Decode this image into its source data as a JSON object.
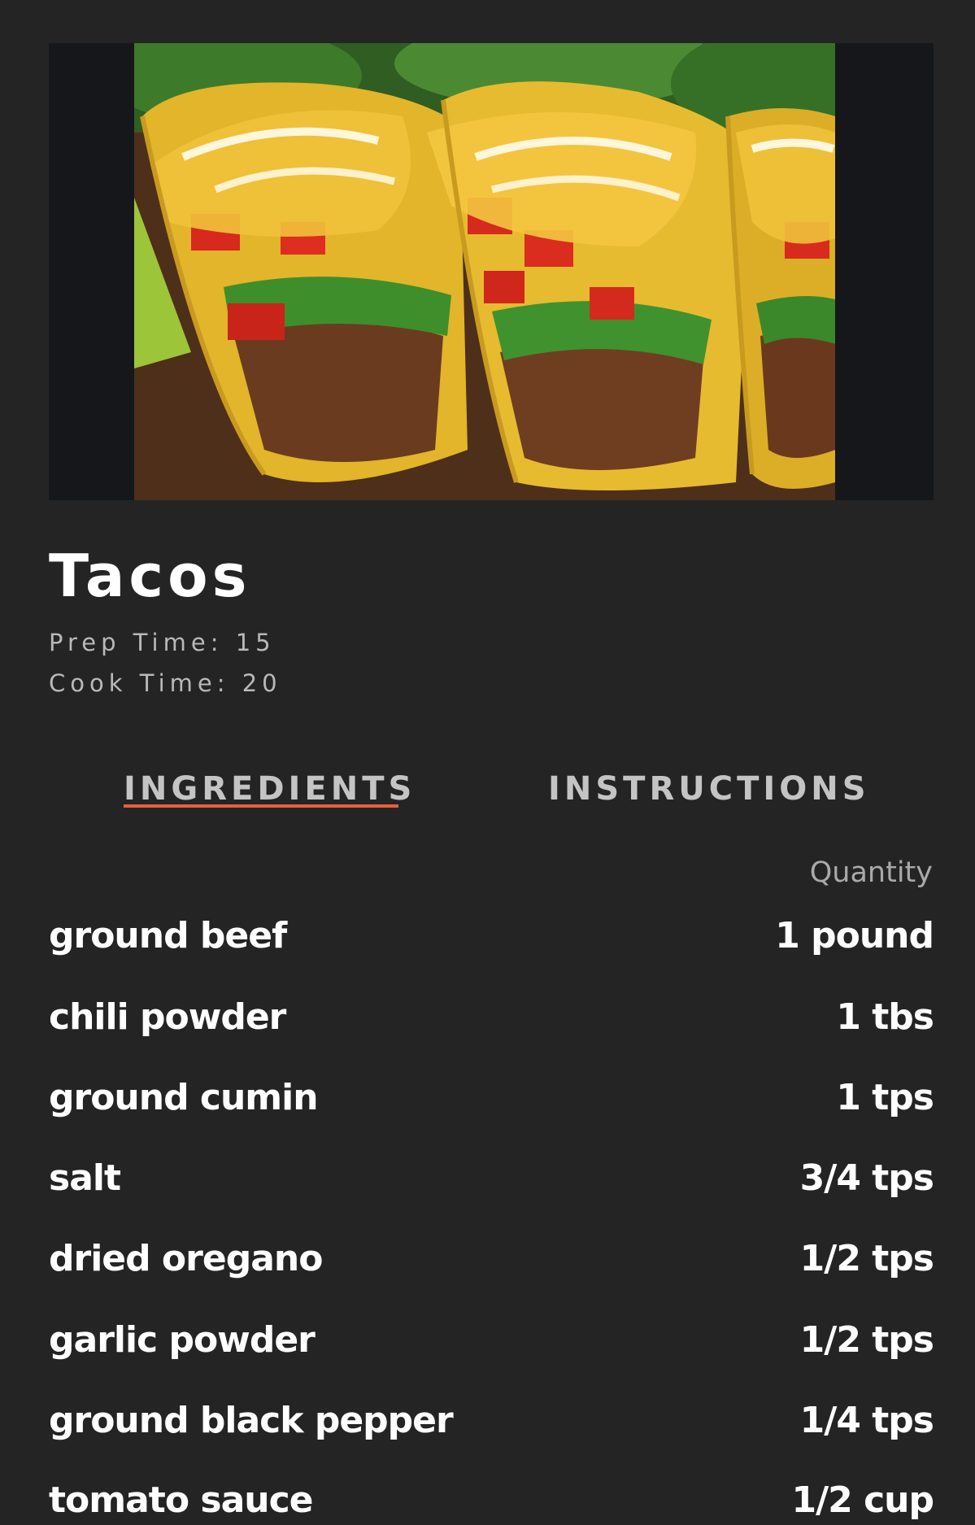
{
  "recipe": {
    "image_alt": "Tacos",
    "title": "Tacos",
    "prep_time": "Prep Time: 15",
    "cook_time": "Cook Time: 20"
  },
  "tabs": [
    {
      "label": "INGREDIENTS",
      "active": true
    },
    {
      "label": "INSTRUCTIONS",
      "active": false
    }
  ],
  "ingredients": {
    "quantity_header": "Quantity",
    "items": [
      {
        "name": "ground beef",
        "quantity": "1 pound"
      },
      {
        "name": "chili powder",
        "quantity": "1 tbs"
      },
      {
        "name": "ground cumin",
        "quantity": "1 tps"
      },
      {
        "name": "salt",
        "quantity": "3/4 tps"
      },
      {
        "name": "dried oregano",
        "quantity": "1/2 tps"
      },
      {
        "name": "garlic powder",
        "quantity": "1/2 tps"
      },
      {
        "name": "ground black pepper",
        "quantity": "1/4 tps"
      },
      {
        "name": "tomato sauce",
        "quantity": "1/2 cup"
      }
    ]
  },
  "colors": {
    "background": "#242424",
    "accent_underline": "#e8603c"
  }
}
